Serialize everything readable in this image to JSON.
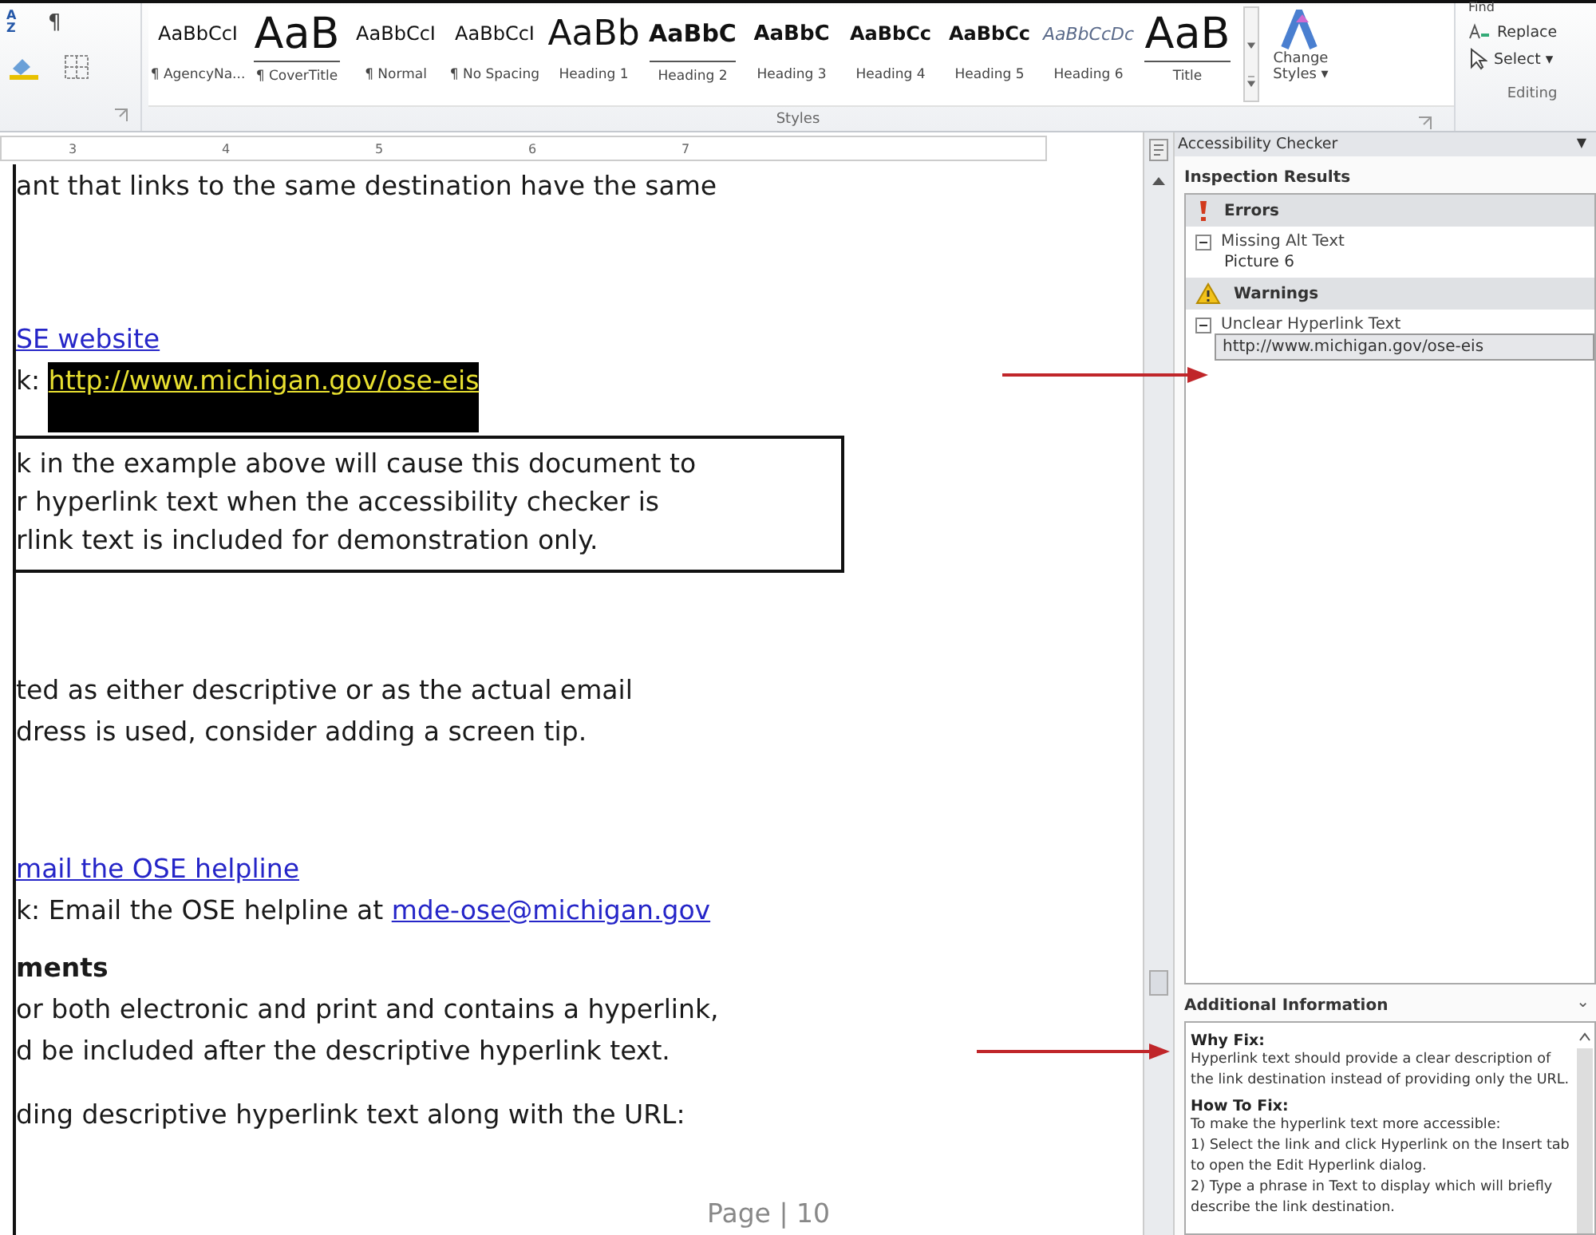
{
  "ribbon": {
    "paragraph_tools": [
      {
        "kind": "sort",
        "label": "A Z"
      },
      {
        "kind": "pilcrow",
        "label": "¶"
      }
    ],
    "styles": [
      {
        "sample": "AaBbCcI",
        "label": "¶ AgencyNa...",
        "kind": "body"
      },
      {
        "sample": "AaB",
        "label": "¶ CoverTitle",
        "kind": "cover"
      },
      {
        "sample": "AaBbCcI",
        "label": "¶ Normal",
        "kind": "body"
      },
      {
        "sample": "AaBbCcI",
        "label": "¶ No Spacing",
        "kind": "body"
      },
      {
        "sample": "AaBb",
        "label": "Heading 1",
        "kind": "h1"
      },
      {
        "sample": "AaBbC",
        "label": "Heading 2",
        "kind": "h2"
      },
      {
        "sample": "AaBbC",
        "label": "Heading 3",
        "kind": "h3"
      },
      {
        "sample": "AaBbCc",
        "label": "Heading 4",
        "kind": "h4"
      },
      {
        "sample": "AaBbCc",
        "label": "Heading 5",
        "kind": "h4"
      },
      {
        "sample": "AaBbCcDc",
        "label": "Heading 6",
        "kind": "italic"
      },
      {
        "sample": "AaB",
        "label": "Title",
        "kind": "cover"
      }
    ],
    "styles_group": "Styles",
    "change_styles": "Change Styles",
    "change_styles_caret": "▾",
    "editing": {
      "find": "Find",
      "replace": "Replace",
      "select": "Select",
      "caret": "▾",
      "group": "Editing"
    }
  },
  "ruler": {
    "ticks": [
      "3",
      "4",
      "5",
      "6",
      "7"
    ]
  },
  "document": {
    "blocks": [
      {
        "kind": "text",
        "text": "ant that links to the same destination have the same"
      },
      {
        "kind": "link",
        "text": "SE website"
      },
      {
        "kind": "highlight",
        "text": "k: ",
        "link": "http://www.michigan.gov/ose-eis"
      },
      {
        "kind": "callout",
        "lines": [
          "k in the example above will cause this document to",
          "r hyperlink text when the accessibility checker is",
          "rlink text is included for demonstration only."
        ]
      },
      {
        "kind": "text",
        "text": "ted as either descriptive or as the actual email"
      },
      {
        "kind": "text",
        "text": "dress is used, consider adding a screen tip."
      },
      {
        "kind": "link",
        "text": "mail the OSE helpline"
      },
      {
        "kind": "mixed",
        "text": "k: Email the OSE helpline at ",
        "link": "mde-ose@michigan.gov"
      },
      {
        "kind": "heading",
        "text": "ments"
      },
      {
        "kind": "text",
        "text": "or both electronic and print and contains a hyperlink,"
      },
      {
        "kind": "text",
        "text": "d be included after the descriptive hyperlink text."
      },
      {
        "kind": "text",
        "text": "ding descriptive hyperlink text along with the URL:"
      }
    ],
    "footer": "Page | 10"
  },
  "task_pane": {
    "title": "Accessibility Checker",
    "menu": "▼",
    "results_title": "Inspection Results",
    "sections": [
      {
        "kind": "error",
        "title": "Errors",
        "issues": [
          {
            "name": "Missing Alt Text",
            "expanded": true,
            "children": [
              {
                "name": "Picture 6",
                "selected": false
              }
            ]
          }
        ]
      },
      {
        "kind": "warning",
        "title": "Warnings",
        "issues": [
          {
            "name": "Unclear Hyperlink Text",
            "expanded": true,
            "children": [
              {
                "name": "http://www.michigan.gov/ose-eis",
                "selected": true
              }
            ]
          }
        ]
      }
    ],
    "info_title": "Additional Information",
    "info_toggle": "⌄",
    "info": [
      {
        "kind": "heading",
        "text": "Why Fix:"
      },
      {
        "kind": "text",
        "text": "Hyperlink text should provide a clear description of the link destination instead of providing only the URL."
      },
      {
        "kind": "heading",
        "text": "How To Fix:"
      },
      {
        "kind": "text",
        "text": "To make the hyperlink text more accessible:"
      },
      {
        "kind": "text",
        "text": "1) Select the link and click Hyperlink on the Insert tab to open the Edit Hyperlink dialog."
      },
      {
        "kind": "text",
        "text": "2) Type a phrase in Text to display which will briefly"
      },
      {
        "kind": "text",
        "text": "describe the link destination."
      }
    ]
  }
}
